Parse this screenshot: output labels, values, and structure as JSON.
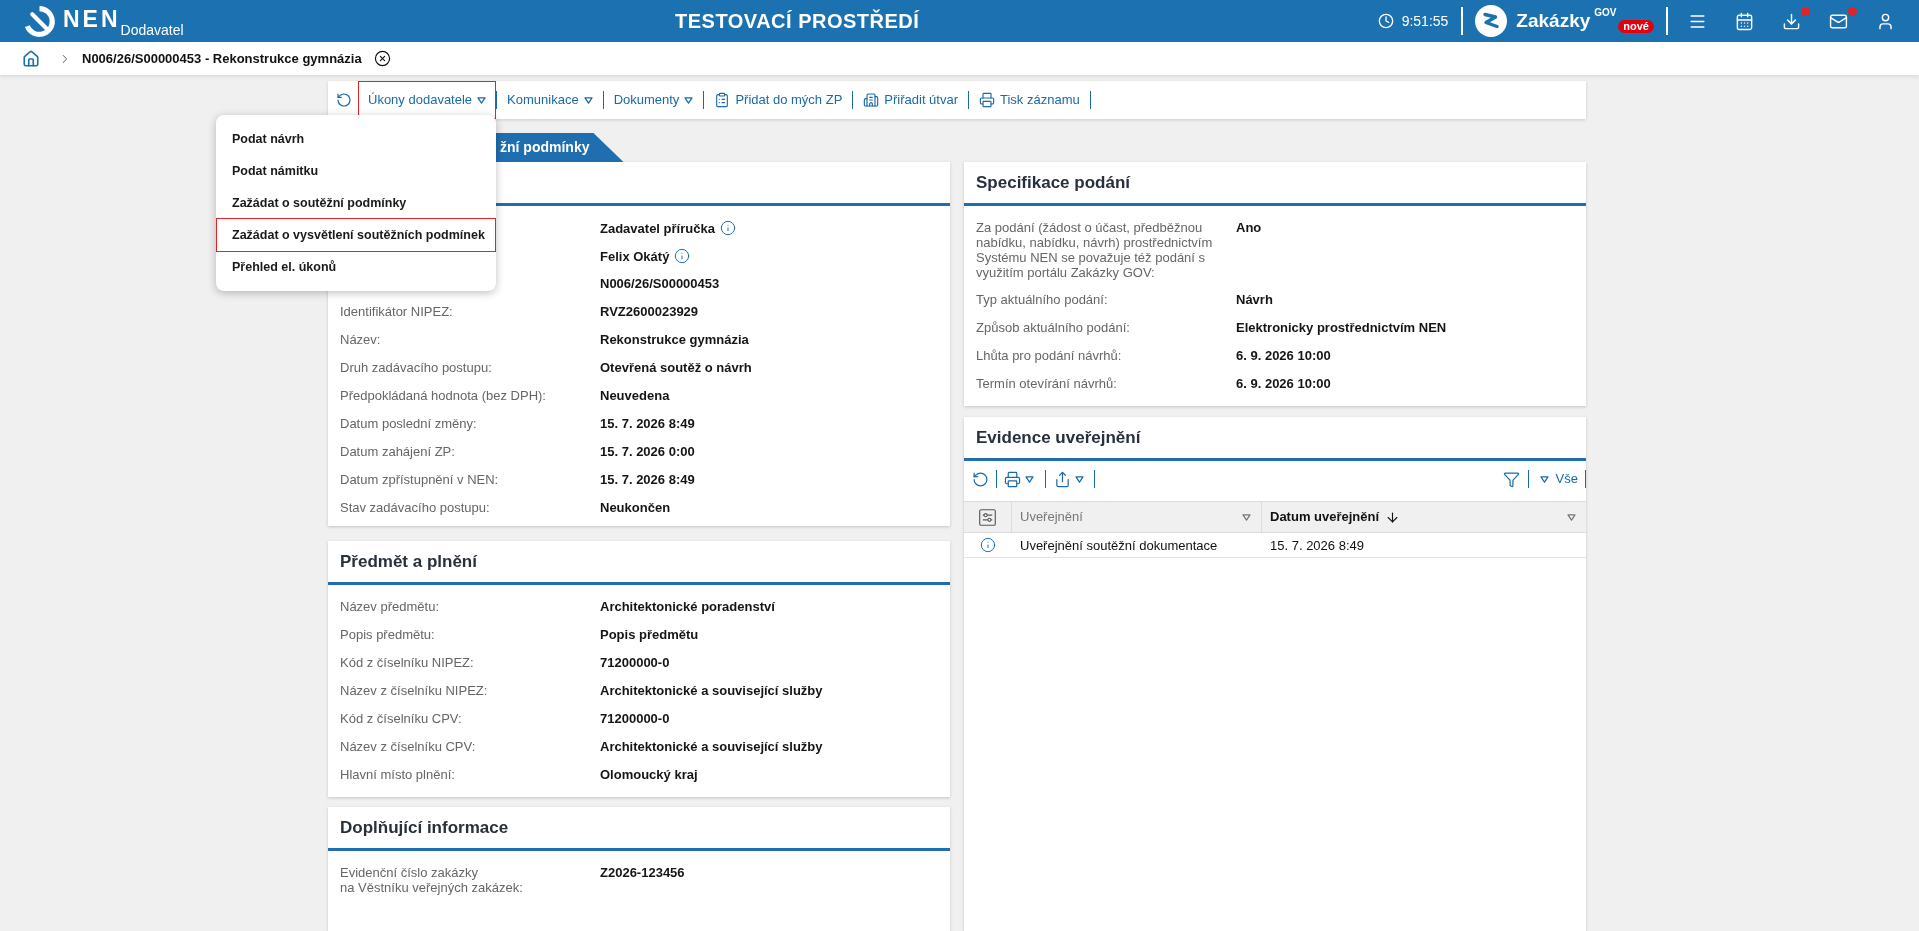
{
  "header": {
    "logo_text": "NEN",
    "logo_subtitle": "Dodavatel",
    "environment": "TESTOVACÍ PROSTŘEDÍ",
    "time": "9:51:55",
    "portal": {
      "name": "Zakázky",
      "superscript": "GOV",
      "badge": "nové"
    },
    "icons": [
      {
        "badge": false
      },
      {
        "badge": false
      },
      {
        "badge": true
      },
      {
        "badge": true
      },
      {
        "badge": false
      }
    ]
  },
  "breadcrumb": {
    "title": "N006/26/S00000453 - Rekonstrukce gymnázia"
  },
  "toolbar": [
    {
      "label": "Úkony dodavatele",
      "kind": "dropdown",
      "open": true
    },
    {
      "label": "Komunikace",
      "kind": "dropdown",
      "open": false
    },
    {
      "label": "Dokumenty",
      "kind": "dropdown",
      "open": false
    },
    {
      "label": "Přidat do mých ZP",
      "kind": "action",
      "open": false
    },
    {
      "label": "Přiřadit útvar",
      "kind": "action",
      "open": false
    },
    {
      "label": "Tisk záznamu",
      "kind": "action",
      "open": false
    }
  ],
  "dropdown_menu": [
    {
      "label": "Podat návrh",
      "selected": false
    },
    {
      "label": "Podat námitku",
      "selected": false
    },
    {
      "label": "Zažádat o soutěžní podmínky",
      "selected": false
    },
    {
      "label": "Zažádat o vysvětlení soutěžních podmínek",
      "selected": true
    },
    {
      "label": "Přehled el. úkonů",
      "selected": false
    }
  ],
  "tabs": [
    {
      "label": "žní podmínky",
      "selected": true
    }
  ],
  "left_cards": [
    {
      "rows": [
        {
          "value": "Zadavatel příručka",
          "info": true
        },
        {
          "value": "Felix Okátý",
          "info": true
        },
        {
          "value": "N006/26/S00000453",
          "info": false
        },
        {
          "label": "Identifikátor NIPEZ:",
          "value": "RVZ2600023929",
          "info": false
        },
        {
          "label": "Název:",
          "value": "Rekonstrukce gymnázia",
          "info": false
        },
        {
          "label": "Druh zadávacího postupu:",
          "value": "Otevřená soutěž o návrh",
          "info": false
        },
        {
          "label": "Předpokládaná hodnota (bez DPH):",
          "value": "Neuvedena",
          "info": false
        },
        {
          "label": "Datum poslední změny:",
          "value": "15. 7. 2026 8:49",
          "info": false
        },
        {
          "label": "Datum zahájení ZP:",
          "value": "15. 7. 2026 0:00",
          "info": false
        },
        {
          "label": "Datum zpřístupnění v NEN:",
          "value": "15. 7. 2026 8:49",
          "info": false
        },
        {
          "label": "Stav zadávacího postupu:",
          "value": "Neukončen",
          "info": false
        }
      ]
    },
    {
      "title": "Předmět a plnění",
      "rows": [
        {
          "label": "Název předmětu:",
          "value": "Architektonické poradenství"
        },
        {
          "label": "Popis předmětu:",
          "value": "Popis předmětu"
        },
        {
          "label": "Kód z číselníku NIPEZ:",
          "value": "71200000-0"
        },
        {
          "label": "Název z číselníku NIPEZ:",
          "value": "Architektonické a související služby"
        },
        {
          "label": "Kód z číselníku CPV:",
          "value": "71200000-0"
        },
        {
          "label": "Název z číselníku CPV:",
          "value": "Architektonické a související služby"
        },
        {
          "label": "Hlavní místo plnění:",
          "value": "Olomoucký kraj"
        }
      ]
    },
    {
      "title": "Doplňující informace",
      "rows": [
        {
          "label": "Evidenční číslo zakázky\nna Věstníku veřejných zakázek:",
          "value": "Z2026-123456"
        }
      ]
    }
  ],
  "submission_spec": {
    "title": "Specifikace podání",
    "rows": [
      {
        "label": "Za podání (žádost o účast, předběžnou nabídku, nabídku, návrh) prostřednictvím Systému NEN se považuje též podání s využitím portálu Zakázky GOV:",
        "value": "Ano"
      },
      {
        "label": "Typ aktuálního podání:",
        "value": "Návrh"
      },
      {
        "label": "Způsob aktuálního podání:",
        "value": "Elektronicky prostřednictvím NEN"
      },
      {
        "label": "Lhůta pro podání návrhů:",
        "value": "6. 9. 2026 10:00"
      },
      {
        "label": "Termín otevírání návrhů:",
        "value": "6. 9. 2026 10:00"
      }
    ]
  },
  "publications": {
    "title": "Evidence uveřejnění",
    "filter_label": "Vše",
    "columns": [
      {
        "label": "Uveřejnění",
        "sorted": false
      },
      {
        "label": "Datum uveřejnění",
        "sorted": true
      }
    ],
    "rows": [
      {
        "cells": [
          "Uveřejnění soutěžní dokumentace",
          "15. 7. 2026 8:49"
        ]
      }
    ]
  }
}
